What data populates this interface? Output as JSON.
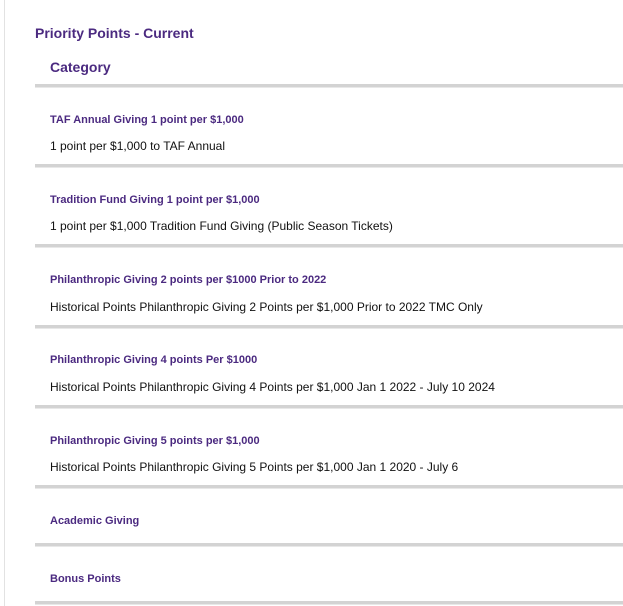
{
  "page_title": "Priority Points - Current",
  "table": {
    "column_header": "Category",
    "categories": [
      {
        "title": "TAF Annual Giving 1 point per $1,000",
        "description": "1 point per $1,000 to TAF Annual"
      },
      {
        "title": "Tradition Fund Giving 1 point per $1,000",
        "description": "1 point per $1,000 Tradition Fund Giving (Public Season Tickets)"
      },
      {
        "title": "Philanthropic Giving 2 points per $1000 Prior to 2022",
        "description": "Historical Points Philanthropic Giving 2 Points per $1,000 Prior to 2022 TMC Only"
      },
      {
        "title": "Philanthropic Giving 4 points Per $1000",
        "description": "Historical Points Philanthropic Giving 4 Points per $1,000 Jan 1 2022 - July 10 2024"
      },
      {
        "title": "Philanthropic Giving 5 points per $1,000",
        "description": "Historical Points Philanthropic Giving 5 Points per $1,000 Jan 1 2020 - July 6"
      },
      {
        "title": "Academic Giving",
        "description": ""
      },
      {
        "title": "Bonus Points",
        "description": ""
      }
    ]
  },
  "colors": {
    "heading": "#4b2a80",
    "text": "#111111",
    "divider": "#d3d3d3"
  }
}
